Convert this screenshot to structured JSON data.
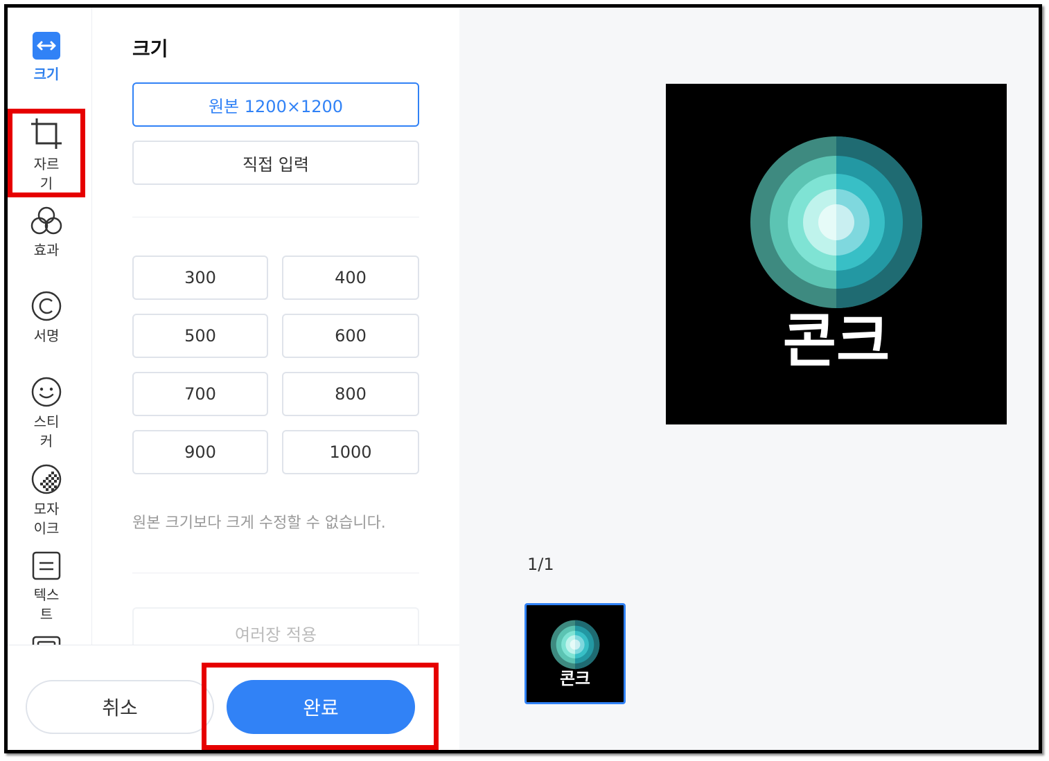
{
  "sidebar": {
    "tools": [
      {
        "label": "크기",
        "icon": "resize-icon",
        "active": true
      },
      {
        "label": "자르기",
        "icon": "crop-icon",
        "active": false
      },
      {
        "label": "효과",
        "icon": "effects-icon",
        "active": false
      },
      {
        "label": "서명",
        "icon": "copyright-icon",
        "active": false
      },
      {
        "label": "스티커",
        "icon": "smiley-icon",
        "active": false
      },
      {
        "label": "모자이크",
        "icon": "mosaic-icon",
        "active": false
      },
      {
        "label": "텍스트",
        "icon": "text-icon",
        "active": false
      }
    ]
  },
  "panel": {
    "title": "크기",
    "original_label": "원본 1200×1200",
    "custom_label": "직접 입력",
    "sizes": [
      "300",
      "400",
      "500",
      "600",
      "700",
      "800",
      "900",
      "1000"
    ],
    "notice": "원본 크기보다 크게 수정할 수 없습니다.",
    "apply_all_label": "여러장 적용"
  },
  "footer": {
    "cancel_label": "취소",
    "done_label": "완료"
  },
  "preview": {
    "logo_text": "콘크",
    "page_indicator": "1/1"
  },
  "colors": {
    "accent": "#3182f6",
    "highlight": "#e60000",
    "preview_bg": "#000000"
  }
}
